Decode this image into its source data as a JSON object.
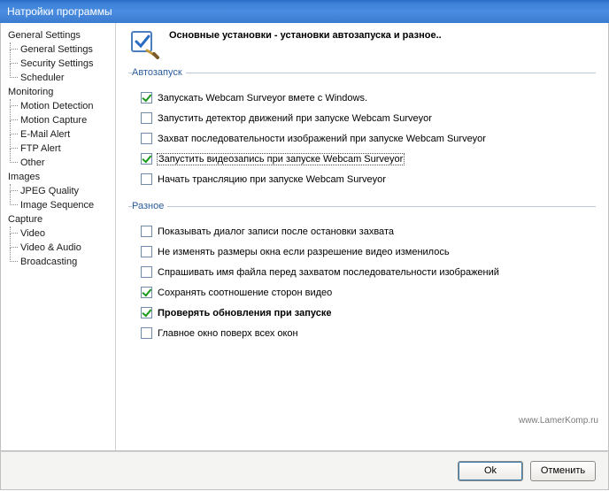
{
  "window": {
    "title": "Натройки программы"
  },
  "tree": {
    "general": {
      "label": "General Settings",
      "items": [
        "General Settings",
        "Security Settings",
        "Scheduler"
      ]
    },
    "monitoring": {
      "label": "Monitoring",
      "items": [
        "Motion Detection",
        "Motion Capture",
        "E-Mail Alert",
        "FTP Alert",
        "Other"
      ]
    },
    "images": {
      "label": "Images",
      "items": [
        "JPEG Quality",
        "Image Sequence"
      ]
    },
    "capture": {
      "label": "Capture",
      "items": [
        "Video",
        "Video & Audio",
        "Broadcasting"
      ]
    }
  },
  "page": {
    "title": "Основные установки - установки автозапуска и разное.."
  },
  "groups": {
    "autostart": {
      "legend": "Автозапуск",
      "items": [
        {
          "label": "Запускать Webcam Surveyor вмете с Windows.",
          "checked": true
        },
        {
          "label": "Запустить детектор движений при запуске Webcam Surveyor",
          "checked": false
        },
        {
          "label": "Захват последовательности изображений при запуске Webcam Surveyor",
          "checked": false
        },
        {
          "label": "Запустить видеозапись при запуске Webcam Surveyor",
          "checked": true,
          "focused": true
        },
        {
          "label": "Начать трансляцию при запуске Webcam Surveyor",
          "checked": false
        }
      ]
    },
    "misc": {
      "legend": "Разное",
      "items": [
        {
          "label": "Показывать диалог записи после остановки захвата",
          "checked": false
        },
        {
          "label": "Не изменять размеры окна если разрешение видео изменилось",
          "checked": false
        },
        {
          "label": "Спрашивать имя файла перед захватом последовательности изображений",
          "checked": false
        },
        {
          "label": "Сохранять соотношение сторон видео",
          "checked": true
        },
        {
          "label": "Проверять обновления при запуске",
          "checked": true,
          "bold": true
        },
        {
          "label": "Главное окно поверх всех окон",
          "checked": false
        }
      ]
    }
  },
  "buttons": {
    "ok": "Ok",
    "cancel": "Отменить"
  },
  "watermark": "www.LamerKomp.ru"
}
